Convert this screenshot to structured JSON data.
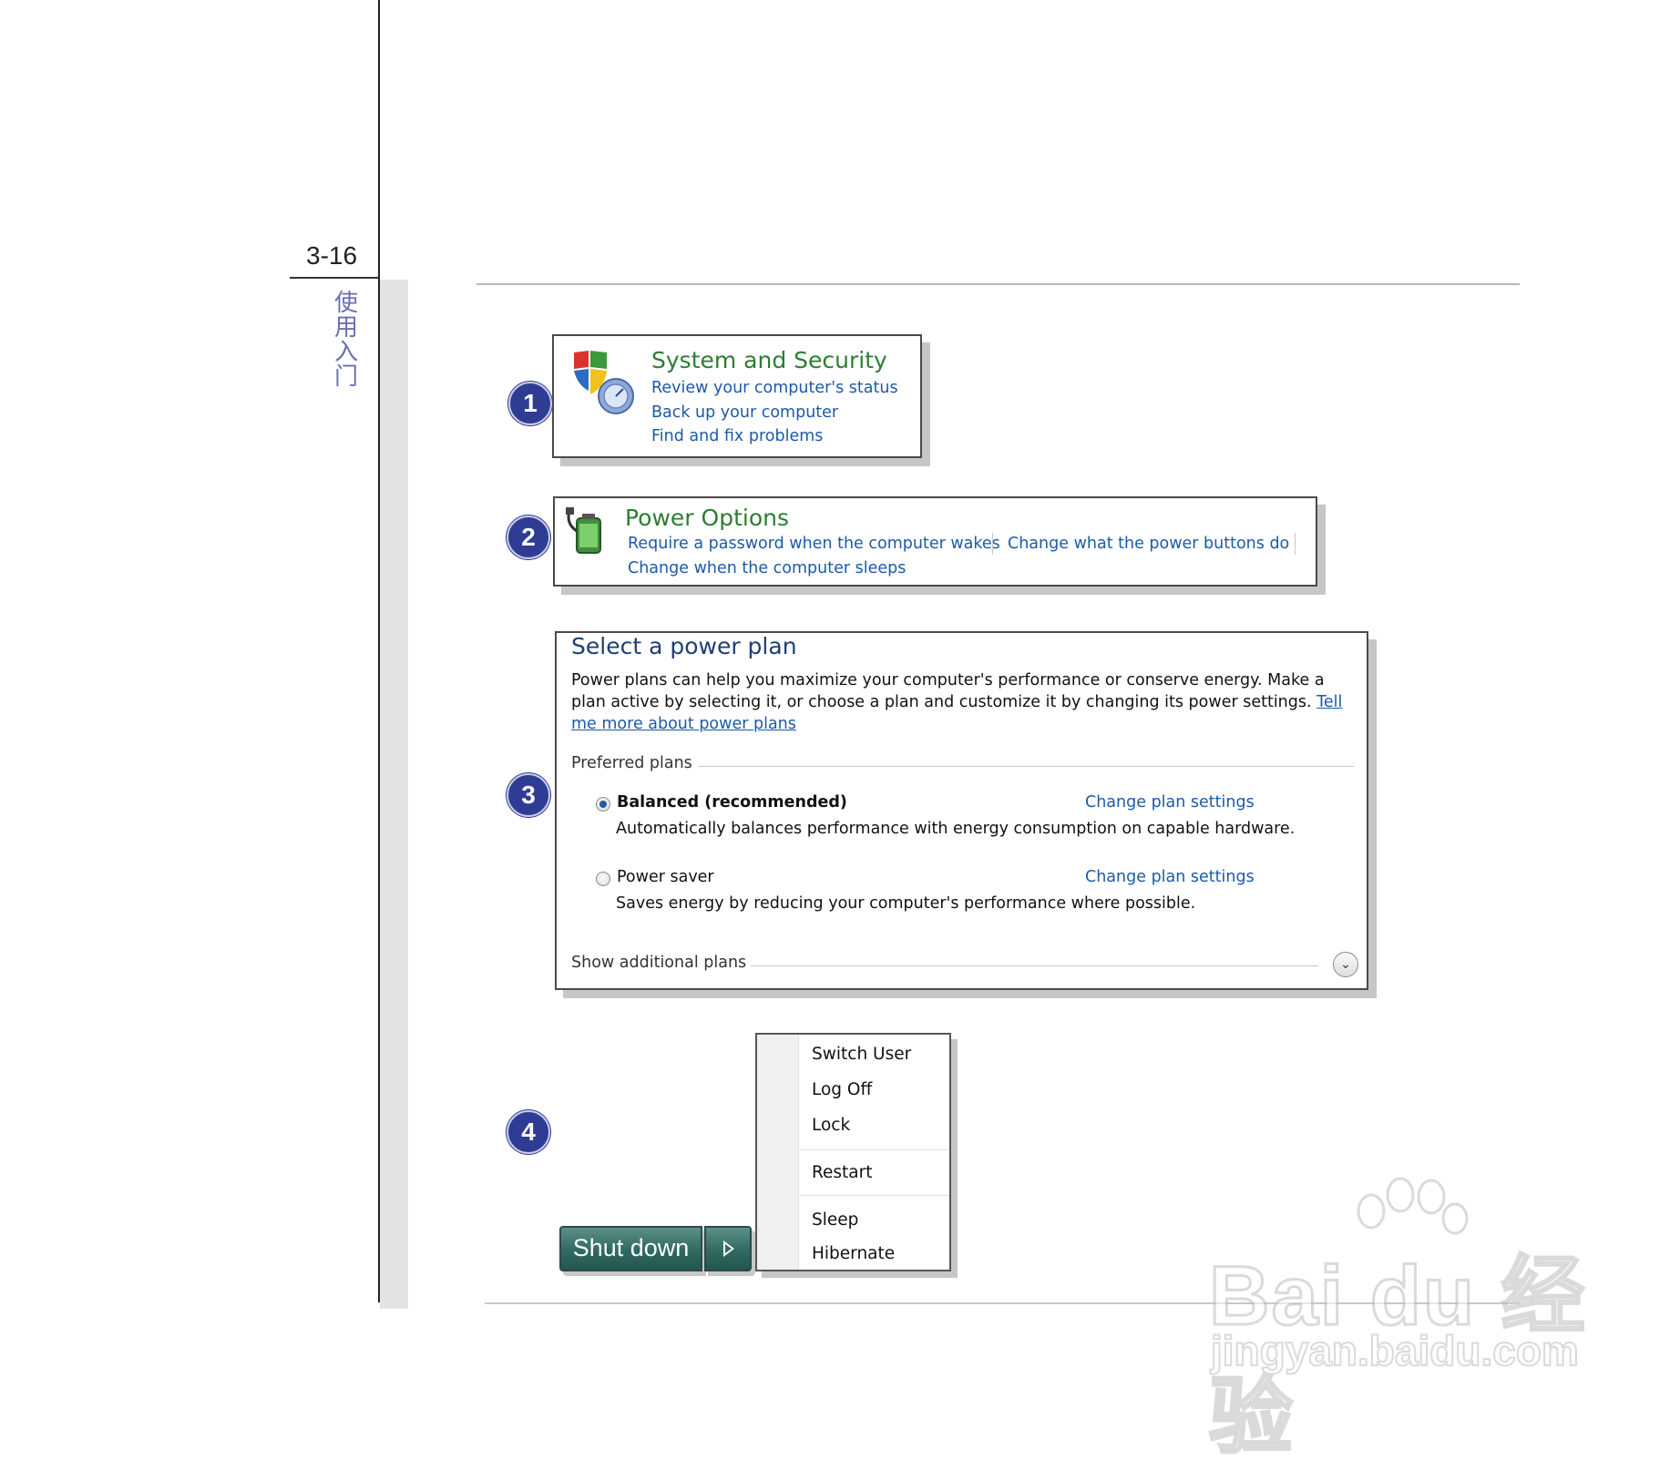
{
  "page": {
    "number": "3-16",
    "chapter": [
      "使",
      "用",
      "入",
      "门"
    ]
  },
  "badges": [
    "1",
    "2",
    "3",
    "4"
  ],
  "system_security": {
    "icon": "shield-icon",
    "title": "System and Security",
    "links": [
      "Review your computer's status",
      "Back up your computer",
      "Find and fix problems"
    ]
  },
  "power_options": {
    "icon": "battery-plug-icon",
    "title": "Power Options",
    "links": [
      "Require a password when the computer wakes",
      "Change what the power buttons do",
      "Change when the computer sleeps"
    ]
  },
  "power_plan": {
    "title": "Select a power plan",
    "description": "Power plans can help you maximize your computer's performance or conserve energy. Make a plan active by selecting it, or choose a plan and customize it by changing its power settings. ",
    "learn_more": "Tell me more about power plans",
    "preferred_label": "Preferred plans",
    "plans": [
      {
        "name": "Balanced (recommended)",
        "selected": true,
        "link": "Change plan settings",
        "description": "Automatically balances performance with energy consumption on capable hardware."
      },
      {
        "name": "Power saver",
        "selected": false,
        "link": "Change plan settings",
        "description": "Saves energy by reducing your computer's performance where possible."
      }
    ],
    "additional": "Show additional plans"
  },
  "shutdown_menu": {
    "items": [
      "Switch User",
      "Log Off",
      "Lock",
      "Restart",
      "Sleep",
      "Hibernate"
    ]
  },
  "shutdown_button": {
    "label": "Shut down"
  },
  "watermark": {
    "brand": "Bai du 经验",
    "url": "jingyan.baidu.com"
  },
  "colors": {
    "badge": "#2e3c94",
    "link": "#1c5aa8",
    "category_title": "#2e7d32",
    "shutdown_button": "#2f6a62"
  }
}
